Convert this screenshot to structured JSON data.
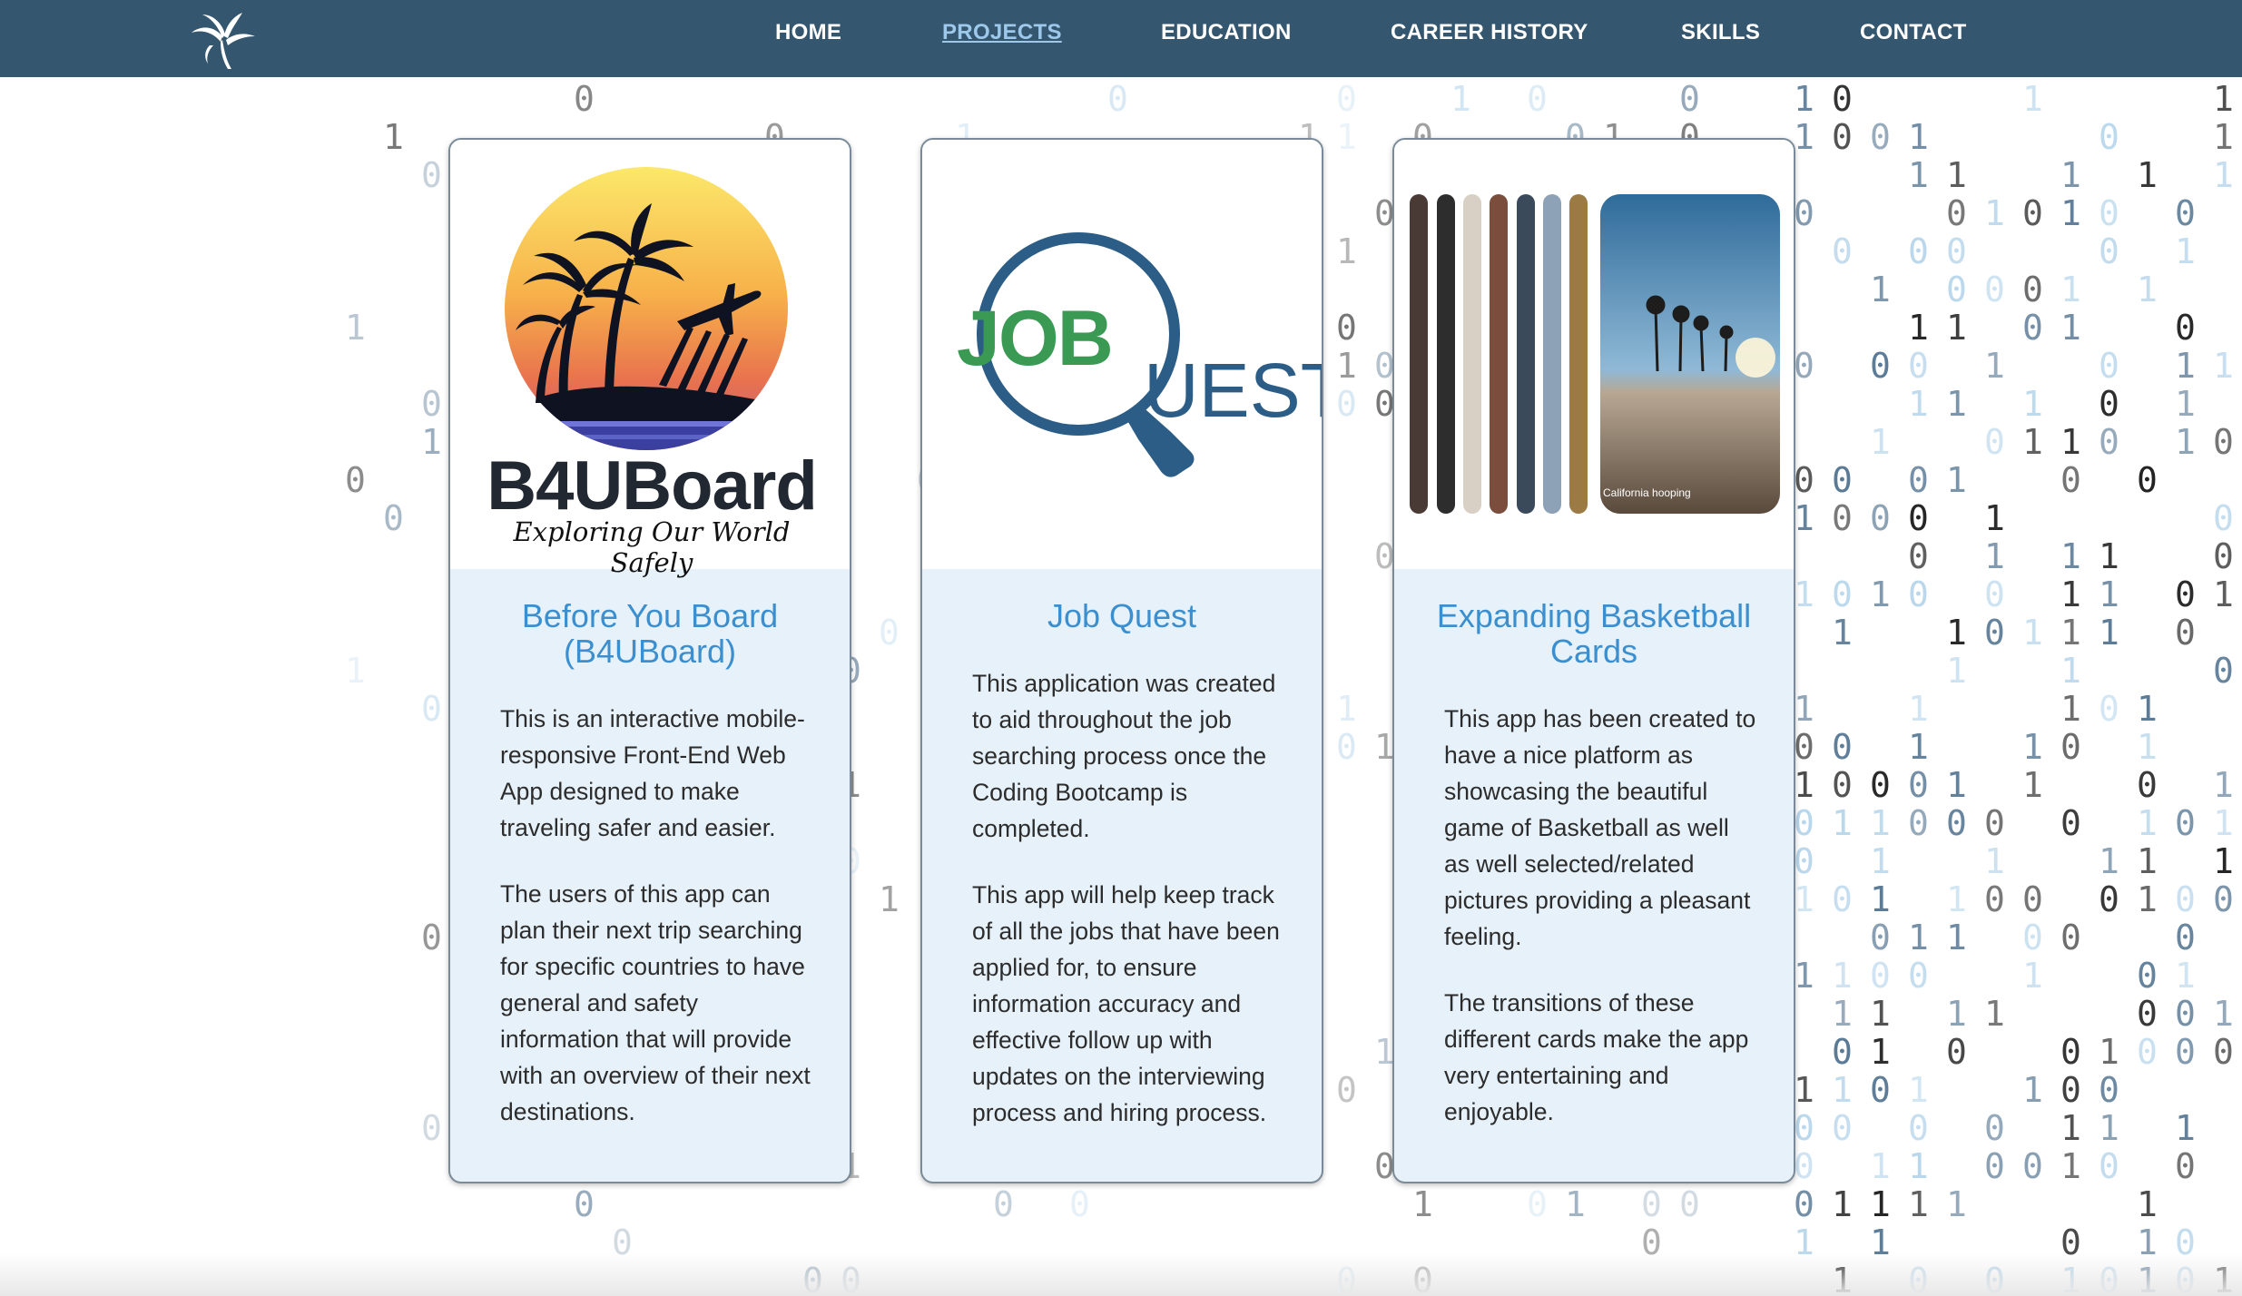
{
  "nav": {
    "items": [
      "HOME",
      "PROJECTS",
      "EDUCATION",
      "CAREER HISTORY",
      "SKILLS",
      "CONTACT"
    ],
    "active": "PROJECTS"
  },
  "colors": {
    "header_bg": "#34566f",
    "title_blue": "#3b8fcf",
    "card_bg": "#e6f1f9",
    "job_green": "#3a9a54",
    "quest_blue": "#2c5d86"
  },
  "cards": [
    {
      "logo_word": "B4UBoard",
      "logo_tagline": "Exploring Our World Safely",
      "title": "Before You Board (B4UBoard)",
      "paragraphs": [
        "This is an interactive mobile-responsive Front-End Web App designed to make traveling safer and easier.",
        "The users of this app can plan their next trip searching for specific countries to have general and safety information that will provide with an overview of their next destinations."
      ]
    },
    {
      "logo_word_1": "JOB",
      "logo_word_2": "UEST",
      "title": "Job Quest",
      "paragraphs": [
        "This application was created to aid throughout the job searching process once the Coding Bootcamp is completed.",
        "This app will help keep track of all the jobs that have been applied for, to ensure information accuracy and effective follow up with updates on the interviewing process and hiring process."
      ]
    },
    {
      "photo_caption": "California hooping",
      "title": "Expanding Basketball Cards",
      "paragraphs": [
        "This app has been created to have a nice platform as showcasing the beautiful game of Basketball as well as well selected/related pictures providing a pleasant feeling.",
        "The transitions of these different cards make the app very entertaining and enjoyable."
      ]
    }
  ]
}
